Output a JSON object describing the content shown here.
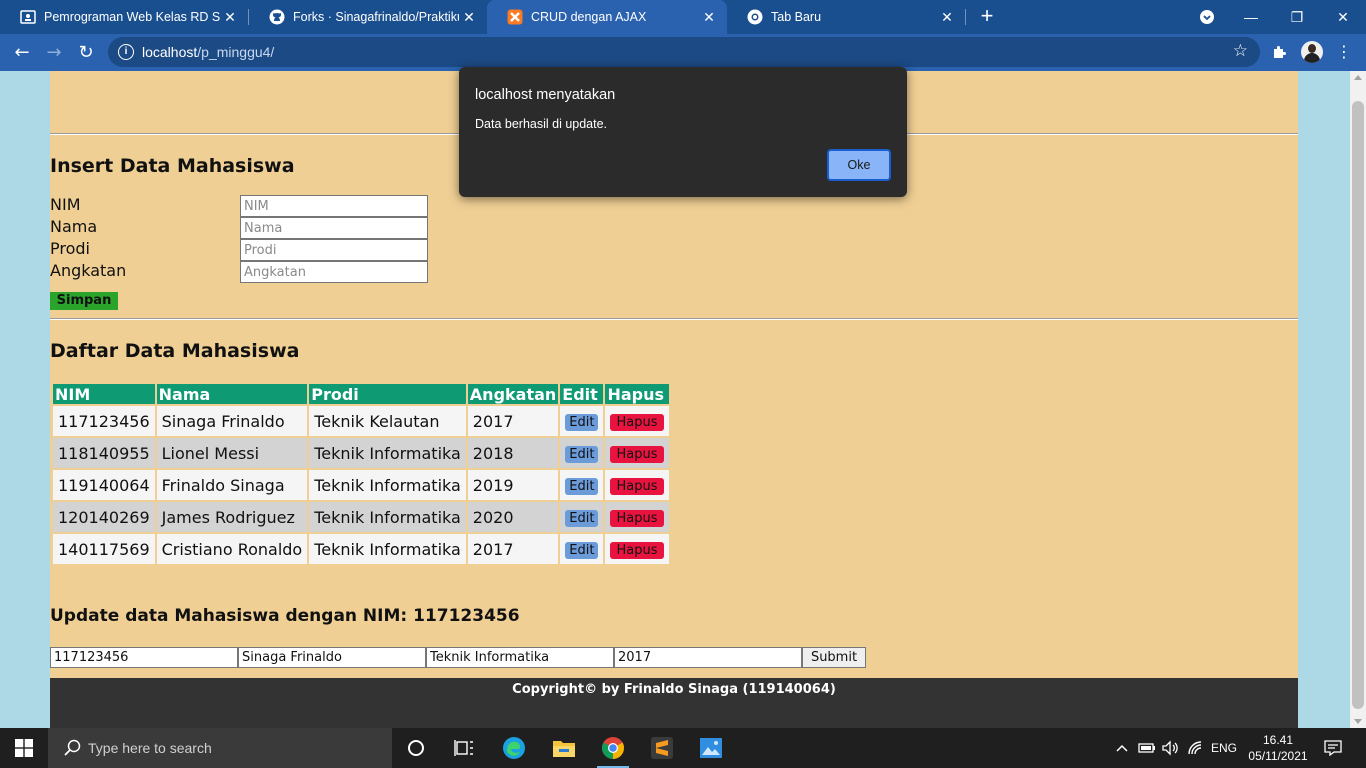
{
  "browser": {
    "tabs": [
      {
        "title": "Pemrograman Web Kelas RD Sem",
        "active": false
      },
      {
        "title": "Forks · Sinagafrinaldo/Praktikum",
        "active": false
      },
      {
        "title": "CRUD dengan AJAX",
        "active": true
      },
      {
        "title": "Tab Baru",
        "active": false
      }
    ],
    "url_host": "localhost",
    "url_path": "/p_minggu4/"
  },
  "insert": {
    "title": "Insert Data Mahasiswa",
    "fields": [
      {
        "label": "NIM",
        "placeholder": "NIM"
      },
      {
        "label": "Nama",
        "placeholder": "Nama"
      },
      {
        "label": "Prodi",
        "placeholder": "Prodi"
      },
      {
        "label": "Angkatan",
        "placeholder": "Angkatan"
      }
    ],
    "button": "Simpan"
  },
  "list": {
    "title": "Daftar Data Mahasiswa",
    "headers": [
      "NIM",
      "Nama",
      "Prodi",
      "Angkatan",
      "Edit",
      "Hapus"
    ],
    "rows": [
      {
        "nim": "117123456",
        "nama": "Sinaga Frinaldo",
        "prodi": "Teknik Kelautan",
        "angkatan": "2017"
      },
      {
        "nim": "118140955",
        "nama": "Lionel Messi",
        "prodi": "Teknik Informatika",
        "angkatan": "2018"
      },
      {
        "nim": "119140064",
        "nama": "Frinaldo Sinaga",
        "prodi": "Teknik Informatika",
        "angkatan": "2019"
      },
      {
        "nim": "120140269",
        "nama": "James Rodriguez",
        "prodi": "Teknik Informatika",
        "angkatan": "2020"
      },
      {
        "nim": "140117569",
        "nama": "Cristiano Ronaldo",
        "prodi": "Teknik Informatika",
        "angkatan": "2017"
      }
    ],
    "edit_label": "Edit",
    "hapus_label": "Hapus"
  },
  "update": {
    "title": "Update data Mahasiswa dengan NIM: 117123456",
    "values": [
      "117123456",
      "Sinaga Frinaldo",
      "Teknik Informatika",
      "2017"
    ],
    "submit": "Submit"
  },
  "footer": "Copyright© by Frinaldo Sinaga (119140064)",
  "dialog": {
    "title": "localhost menyatakan",
    "message": "Data berhasil di update.",
    "ok": "Oke"
  },
  "taskbar": {
    "search_placeholder": "Type here to search",
    "lang": "ENG",
    "time": "16.41",
    "date": "05/11/2021"
  },
  "colors": {
    "page_bg": "#add8e6",
    "container_bg": "#efcf94",
    "table_header": "#0e9a73",
    "simpan": "#2aa42a",
    "edit": "#6b9bd8",
    "hapus": "#e8143f",
    "footer": "#333333"
  }
}
